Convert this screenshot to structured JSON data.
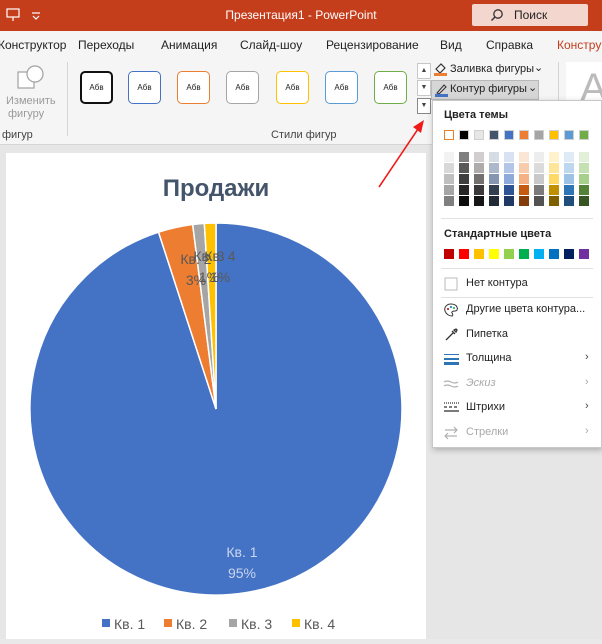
{
  "titlebar": {
    "title": "Презентация1  -  PowerPoint",
    "search_label": "Поиск"
  },
  "tabs": [
    {
      "label": "Конструктор"
    },
    {
      "label": "Переходы"
    },
    {
      "label": "Анимация"
    },
    {
      "label": "Слайд-шоу"
    },
    {
      "label": "Рецензирование"
    },
    {
      "label": "Вид"
    },
    {
      "label": "Справка"
    },
    {
      "label": "Конструк"
    }
  ],
  "ribbon": {
    "change_shape_label_1": "Изменить",
    "change_shape_label_2": "фигуру",
    "left_group_label": "фигур",
    "shape_styles_label": "Стили фигур",
    "style_sample_text": "Абв",
    "fill_label": "Заливка фигуры",
    "outline_label": "Контур фигуры",
    "wordart_letter": "А"
  },
  "dropdown": {
    "theme_colors_label": "Цвета темы",
    "standard_colors_label": "Стандартные цвета",
    "theme_colors": [
      "#ffffff",
      "#000000",
      "#e7e6e6",
      "#44546a",
      "#4472c4",
      "#ed7d31",
      "#a5a5a5",
      "#ffc000",
      "#5b9bd5",
      "#70ad47"
    ],
    "theme_tints": [
      [
        "#f2f2f2",
        "#7f7f7f",
        "#d0cece",
        "#d6dce4",
        "#d9e2f3",
        "#fbe5d5",
        "#ededed",
        "#fff2cc",
        "#deebf6",
        "#e2efd9"
      ],
      [
        "#d8d8d8",
        "#595959",
        "#aeabab",
        "#adb9ca",
        "#b4c6e7",
        "#f7cbac",
        "#dbdbdb",
        "#fee599",
        "#bdd7ee",
        "#c5e0b3"
      ],
      [
        "#bfbfbf",
        "#3f3f3f",
        "#757070",
        "#8496b0",
        "#8eaadb",
        "#f4b183",
        "#c9c9c9",
        "#ffd965",
        "#9cc3e5",
        "#a8d08d"
      ],
      [
        "#a5a5a5",
        "#262626",
        "#3a3838",
        "#323f4f",
        "#2f5496",
        "#c55a11",
        "#7b7b7b",
        "#bf9000",
        "#2e75b5",
        "#538135"
      ],
      [
        "#7f7f7f",
        "#0c0c0c",
        "#171616",
        "#222a35",
        "#1f3864",
        "#843c0b",
        "#525252",
        "#7f6000",
        "#1e4e79",
        "#375623"
      ]
    ],
    "standard_colors": [
      "#c00000",
      "#ff0000",
      "#ffc000",
      "#ffff00",
      "#92d050",
      "#00b050",
      "#00b0f0",
      "#0070c0",
      "#002060",
      "#7030a0"
    ],
    "items": [
      {
        "label": "Нет контура",
        "icon": "no-outline-icon"
      },
      {
        "label": "Другие цвета контура...",
        "icon": "palette-icon"
      },
      {
        "label": "Пипетка",
        "icon": "eyedropper-icon"
      },
      {
        "label": "Толщина",
        "icon": "weight-icon"
      },
      {
        "label": "Эскиз",
        "icon": "sketch-icon"
      },
      {
        "label": "Штрихи",
        "icon": "dashes-icon"
      },
      {
        "label": "Стрелки",
        "icon": "arrows-icon"
      }
    ]
  },
  "chart_data": {
    "type": "pie",
    "title": "Продажи",
    "categories": [
      "Кв. 1",
      "Кв. 2",
      "Кв. 3",
      "Кв. 4"
    ],
    "values": [
      95,
      3,
      1,
      1
    ],
    "data_labels": [
      "95%",
      "3%",
      "1%",
      "1%"
    ],
    "colors": [
      "#4472c4",
      "#ed7d31",
      "#a5a5a5",
      "#ffc000"
    ],
    "legend_position": "bottom"
  }
}
